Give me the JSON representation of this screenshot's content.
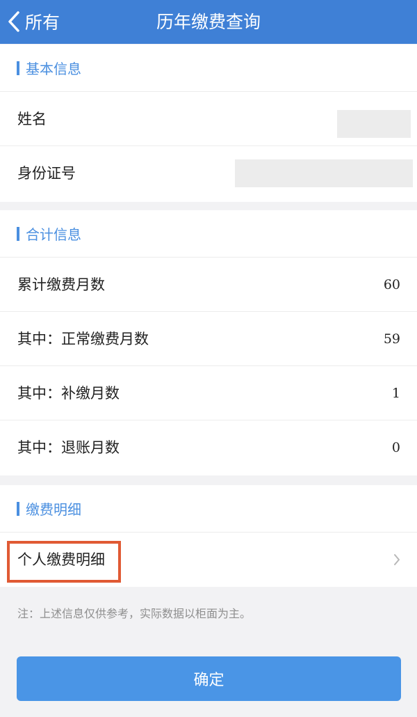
{
  "nav": {
    "back_label": "所有",
    "title": "历年缴费查询"
  },
  "basic_info": {
    "title": "基本信息",
    "name_label": "姓名",
    "id_label": "身份证号"
  },
  "summary": {
    "title": "合计信息",
    "rows": [
      {
        "label": "累计缴费月数",
        "value": "60"
      },
      {
        "label": "其中：正常缴费月数",
        "value": "59"
      },
      {
        "label": "其中：补缴月数",
        "value": "1"
      },
      {
        "label": "其中：退账月数",
        "value": "0"
      }
    ]
  },
  "detail": {
    "title": "缴费明细",
    "personal_label": "个人缴费明细"
  },
  "note": "注：上述信息仅供参考，实际数据以柜面为主。",
  "confirm_label": "确定",
  "colors": {
    "nav_bg": "#3f80d6",
    "accent": "#4a8fe0",
    "button": "#4a95e6",
    "highlight": "#e05a34"
  }
}
